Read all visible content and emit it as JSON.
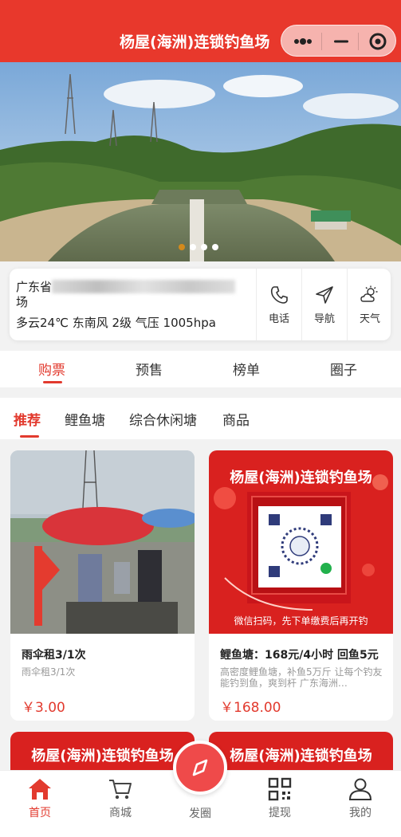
{
  "header": {
    "title": "杨屋(海洲)连锁钓鱼场"
  },
  "banner": {
    "slide_count": 4,
    "active_slide": 0
  },
  "info": {
    "address_prefix": "广东省",
    "address_suffix": "场",
    "weather": "多云24℃  东南风 2级 气压 1005hpa",
    "actions": [
      {
        "label": "电话",
        "icon": "phone-icon"
      },
      {
        "label": "导航",
        "icon": "navigate-icon"
      },
      {
        "label": "天气",
        "icon": "weather-icon"
      }
    ]
  },
  "tabs": [
    {
      "label": "购票",
      "active": true
    },
    {
      "label": "预售",
      "active": false
    },
    {
      "label": "榜单",
      "active": false
    },
    {
      "label": "圈子",
      "active": false
    }
  ],
  "subtabs": [
    {
      "label": "推荐",
      "active": true
    },
    {
      "label": "鲤鱼塘",
      "active": false
    },
    {
      "label": "综合休闲塘",
      "active": false
    },
    {
      "label": "商品",
      "active": false
    }
  ],
  "products": [
    {
      "title": "雨伞租3/1次",
      "desc": "雨伞租3/1次",
      "price": "￥3.00"
    },
    {
      "title": "鲤鱼塘：168元/4小时 回鱼5元",
      "desc": "高密度鲤鱼塘，补鱼5万斤 让每个钓友能钓到鱼，爽到杆 广东海洲…",
      "price": "￥168.00",
      "poster_title": "杨屋(海洲)连锁钓鱼场",
      "poster_caption": "微信扫码，先下单缴费后再开钓"
    }
  ],
  "more_posters": [
    {
      "poster_title": "杨屋(海洲)连锁钓鱼场"
    },
    {
      "poster_title": "杨屋(海洲)连锁钓鱼场"
    }
  ],
  "bottomnav": {
    "items": [
      {
        "label": "首页",
        "icon": "home-icon",
        "active": true
      },
      {
        "label": "商城",
        "icon": "cart-icon",
        "active": false
      },
      {
        "label": "发圈",
        "icon": "compass-icon",
        "active": false
      },
      {
        "label": "提现",
        "icon": "qrcode-icon",
        "active": false
      },
      {
        "label": "我的",
        "icon": "user-icon",
        "active": false
      }
    ]
  },
  "colors": {
    "brand": "#e8382c",
    "accent": "#e23a2e"
  }
}
